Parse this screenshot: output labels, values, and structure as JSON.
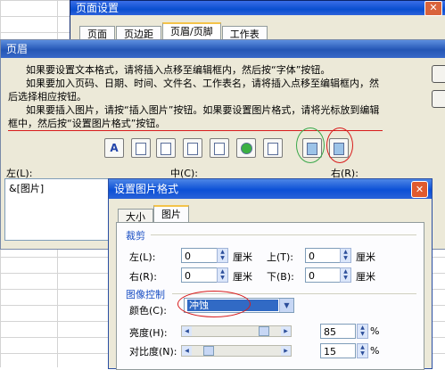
{
  "page_setup": {
    "title": "页面设置",
    "tabs": [
      "页面",
      "页边距",
      "页眉/页脚",
      "工作表"
    ],
    "active_tab": "页眉/页脚"
  },
  "header_dialog": {
    "title": "页眉",
    "help_lines": [
      "如果要设置文本格式，请将插入点移至编辑框内，然后按“字体”按钮。",
      "如果要加入页码、日期、时间、文件名、工作表名，请将插入点移至编辑框内，然后选择相应按钮。",
      "如果要插入图片，请按“插入图片”按钮。如果要设置图片格式，请将光标放到编辑框中，然后按“设置图片格式”按钮。"
    ],
    "toolbar_icons": [
      "font-icon",
      "page-number-icon",
      "total-pages-icon",
      "date-icon",
      "time-icon",
      "file-path-icon",
      "file-name-icon",
      "sheet-name-icon",
      "insert-picture-icon",
      "format-picture-icon"
    ],
    "left_label": "左(L):",
    "center_label": "中(C):",
    "right_label": "右(R):",
    "left_content": "&[图片]"
  },
  "format_picture": {
    "title": "设置图片格式",
    "tabs": [
      "大小",
      "图片"
    ],
    "active_tab": "图片",
    "crop_title": "裁剪",
    "left_label": "左(L):",
    "left_value": "0",
    "top_label": "上(T):",
    "top_value": "0",
    "right_label": "右(R):",
    "right_value": "0",
    "bottom_label": "下(B):",
    "bottom_value": "0",
    "unit": "厘米",
    "image_control_title": "图像控制",
    "color_label": "颜色(C):",
    "color_value": "冲蚀",
    "brightness_label": "亮度(H):",
    "brightness_value": "85",
    "brightness_level": 0.85,
    "contrast_label": "对比度(N):",
    "contrast_value": "15",
    "contrast_level": 0.15,
    "percent": "%"
  }
}
